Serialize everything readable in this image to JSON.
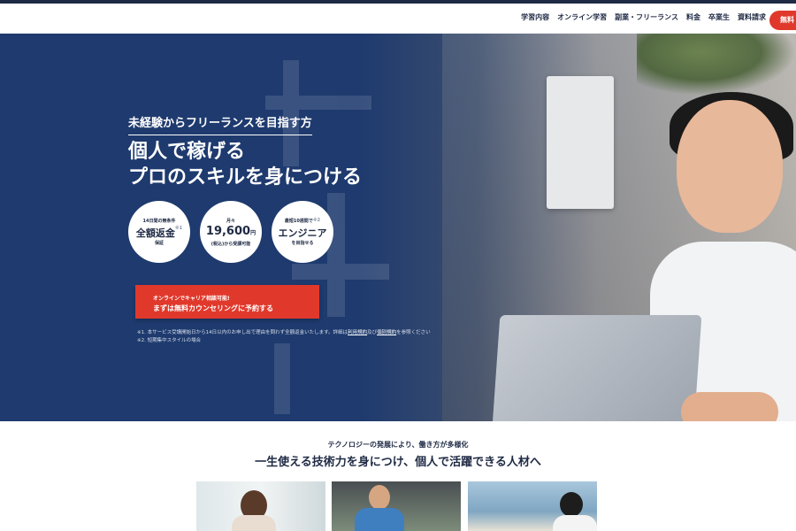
{
  "nav": {
    "items": [
      "学習内容",
      "オンライン学習",
      "副業・フリーランス",
      "料金",
      "卒業生",
      "資料請求"
    ],
    "cta": "無料"
  },
  "hero": {
    "eyebrow": "未経験からフリーランスを目指す方",
    "headline_line1": "個人で稼げる",
    "headline_line2": "プロのスキルを身につける",
    "badges": [
      {
        "top": "14日間の無条件",
        "main": "全額返金",
        "sup": "※1",
        "bottom": "保証"
      },
      {
        "top": "月々",
        "main": "19,600",
        "unit": "円",
        "bottom": "(税込)から受講可能"
      },
      {
        "top": "最短10週間で",
        "sup": "※2",
        "main": "エンジニア",
        "bottom": "を目指せる"
      }
    ],
    "cta_line1": "オンラインでキャリア相談可能!",
    "cta_line2": "まずは無料カウンセリングに予約する",
    "note1_prefix": "※1. 本サービス受講開始日から14日以内のお申し出で理由を問わず全額返金いたします。詳細は",
    "note1_link1": "利用規約",
    "note1_mid": "及び",
    "note1_link2": "個別規約",
    "note1_suffix": "を参照ください",
    "note2": "※2. 短期集中スタイルの場合"
  },
  "section": {
    "subtitle": "テクノロジーの発展により、働き方が多様化",
    "title": "一生使える技術力を身につけ、個人で活躍できる人材へ"
  },
  "colors": {
    "navy": "#1e3a6e",
    "accent_red": "#e0392c",
    "text_dark": "#1f2a44"
  }
}
